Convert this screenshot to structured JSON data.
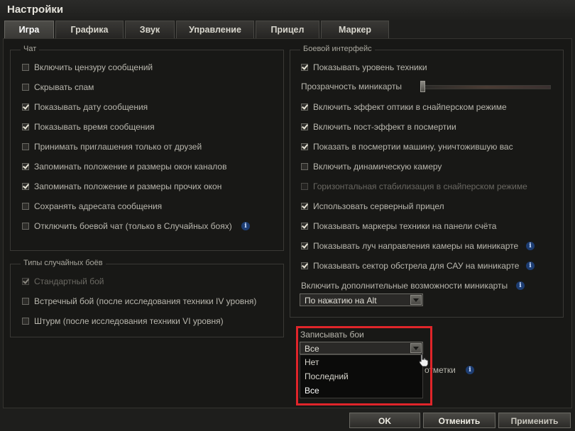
{
  "window": {
    "title": "Настройки"
  },
  "tabs": [
    "Игра",
    "Графика",
    "Звук",
    "Управление",
    "Прицел",
    "Маркер"
  ],
  "chat": {
    "legend": "Чат",
    "items": [
      {
        "label": "Включить цензуру сообщений",
        "checked": false
      },
      {
        "label": "Скрывать спам",
        "checked": false
      },
      {
        "label": "Показывать дату сообщения",
        "checked": true
      },
      {
        "label": "Показывать время сообщения",
        "checked": true
      },
      {
        "label": "Принимать приглашения только от друзей",
        "checked": false
      },
      {
        "label": "Запоминать положение и размеры окон каналов",
        "checked": true
      },
      {
        "label": "Запоминать положение и размеры прочих окон",
        "checked": true
      },
      {
        "label": "Сохранять адресата сообщения",
        "checked": false
      },
      {
        "label": "Отключить боевой чат (только в Случайных боях)",
        "checked": false,
        "info": true
      }
    ]
  },
  "battle_types": {
    "legend": "Типы случайных боёв",
    "items": [
      {
        "label": "Стандартный бой",
        "checked": true,
        "disabled": true
      },
      {
        "label": "Встречный бой (после исследования техники IV уровня)",
        "checked": false
      },
      {
        "label": "Штурм (после исследования техники VI уровня)",
        "checked": false
      }
    ]
  },
  "combat_ui": {
    "legend": "Боевой интерфейс",
    "items": [
      {
        "label": "Показывать уровень техники",
        "checked": true
      }
    ],
    "minimap_opacity_label": "Прозрачность миникарты",
    "minimap_opacity": 0.02,
    "items2": [
      {
        "label": "Включить эффект оптики в снайперском режиме",
        "checked": true
      },
      {
        "label": "Включить пост-эффект в посмертии",
        "checked": true
      },
      {
        "label": "Показать в посмертии машину, уничтожившую вас",
        "checked": true
      },
      {
        "label": "Включить динамическую камеру",
        "checked": false
      },
      {
        "label": "Горизонтальная стабилизация в снайперском режиме",
        "checked": false,
        "disabled": true
      },
      {
        "label": "Использовать серверный прицел",
        "checked": true
      },
      {
        "label": "Показывать маркеры техники на панели счёта",
        "checked": true
      },
      {
        "label": "Показывать луч направления камеры на миникарте",
        "checked": true,
        "info": true
      },
      {
        "label": "Показывать сектор обстрела для САУ на миникарте",
        "checked": true,
        "info": true
      }
    ],
    "minimap_extra_label": "Включить дополнительные возможности миникарты",
    "minimap_extra_value": "По нажатию на Alt"
  },
  "replays": {
    "label": "Записывать бои",
    "value": "Все",
    "options": [
      "Нет",
      "Последний",
      "Все"
    ],
    "partial_label": "отметки"
  },
  "buttons": {
    "ok": "OK",
    "cancel": "Отменить",
    "apply": "Применить"
  },
  "colors": {
    "highlight": "#e0252a",
    "info": "#1d3d72"
  }
}
